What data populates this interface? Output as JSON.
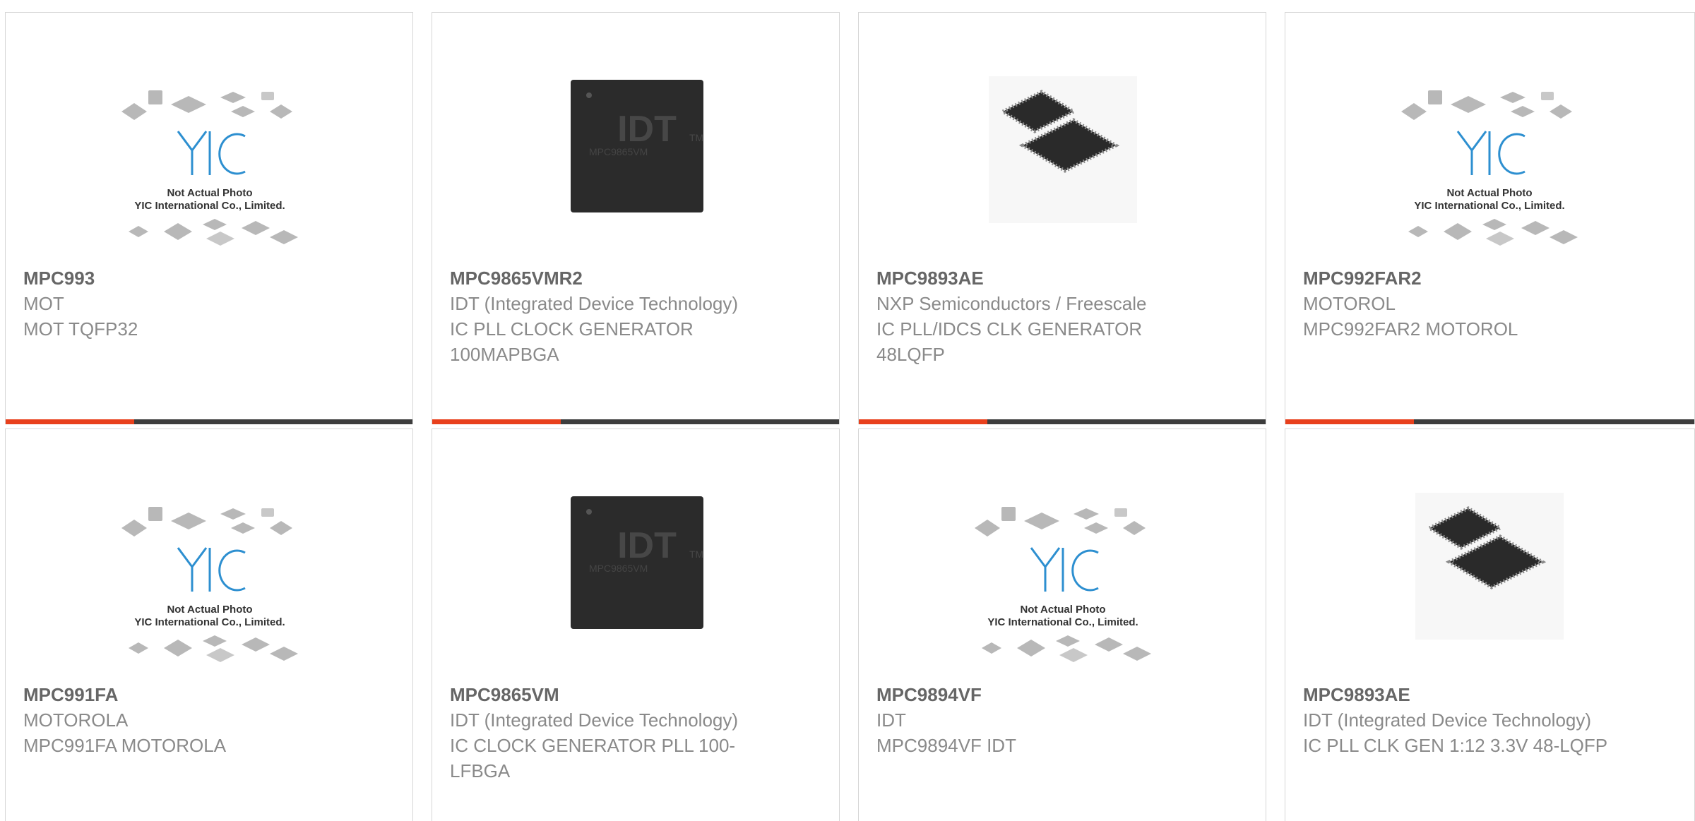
{
  "colors": {
    "accent": "#e8401c",
    "bar": "#3d3d3d",
    "border": "#d6d6d6",
    "part_number": "#666666",
    "text": "#8a8a8a",
    "logo_blue": "#2d8fd0"
  },
  "placeholder": {
    "line1": "Not Actual Photo",
    "line2": "YIC International Co., Limited.",
    "logo": "YIC"
  },
  "idt": {
    "brand": "IDT",
    "tm": "TM",
    "marking_1": "MPC9865VM",
    "marking_2": "MPC9865VM"
  },
  "products": [
    {
      "part": "MPC993",
      "manufacturer": "MOT",
      "description": "MOT TQFP32",
      "image": "placeholder-icon"
    },
    {
      "part": "MPC9865VMR2",
      "manufacturer": "IDT (Integrated Device Technology)",
      "description": "IC PLL CLOCK GENERATOR 100MAPBGA",
      "image": "idt-chip-icon"
    },
    {
      "part": "MPC9893AE",
      "manufacturer": "NXP Semiconductors / Freescale",
      "description": "IC PLL/IDCS CLK GENERATOR 48LQFP",
      "image": "lqfp-chip-icon"
    },
    {
      "part": "MPC992FAR2",
      "manufacturer": "MOTOROL",
      "description": "MPC992FAR2 MOTOROL",
      "image": "placeholder-icon"
    },
    {
      "part": "MPC991FA",
      "manufacturer": "MOTOROLA",
      "description": "MPC991FA MOTOROLA",
      "image": "placeholder-icon"
    },
    {
      "part": "MPC9865VM",
      "manufacturer": "IDT (Integrated Device Technology)",
      "description": "IC CLOCK GENERATOR PLL 100-LFBGA",
      "image": "idt-chip-icon"
    },
    {
      "part": "MPC9894VF",
      "manufacturer": "IDT",
      "description": "MPC9894VF IDT",
      "image": "placeholder-icon"
    },
    {
      "part": "MPC9893AE",
      "manufacturer": "IDT (Integrated Device Technology)",
      "description": "IC PLL CLK GEN 1:12 3.3V 48-LQFP",
      "image": "lqfp-chip-icon"
    }
  ]
}
